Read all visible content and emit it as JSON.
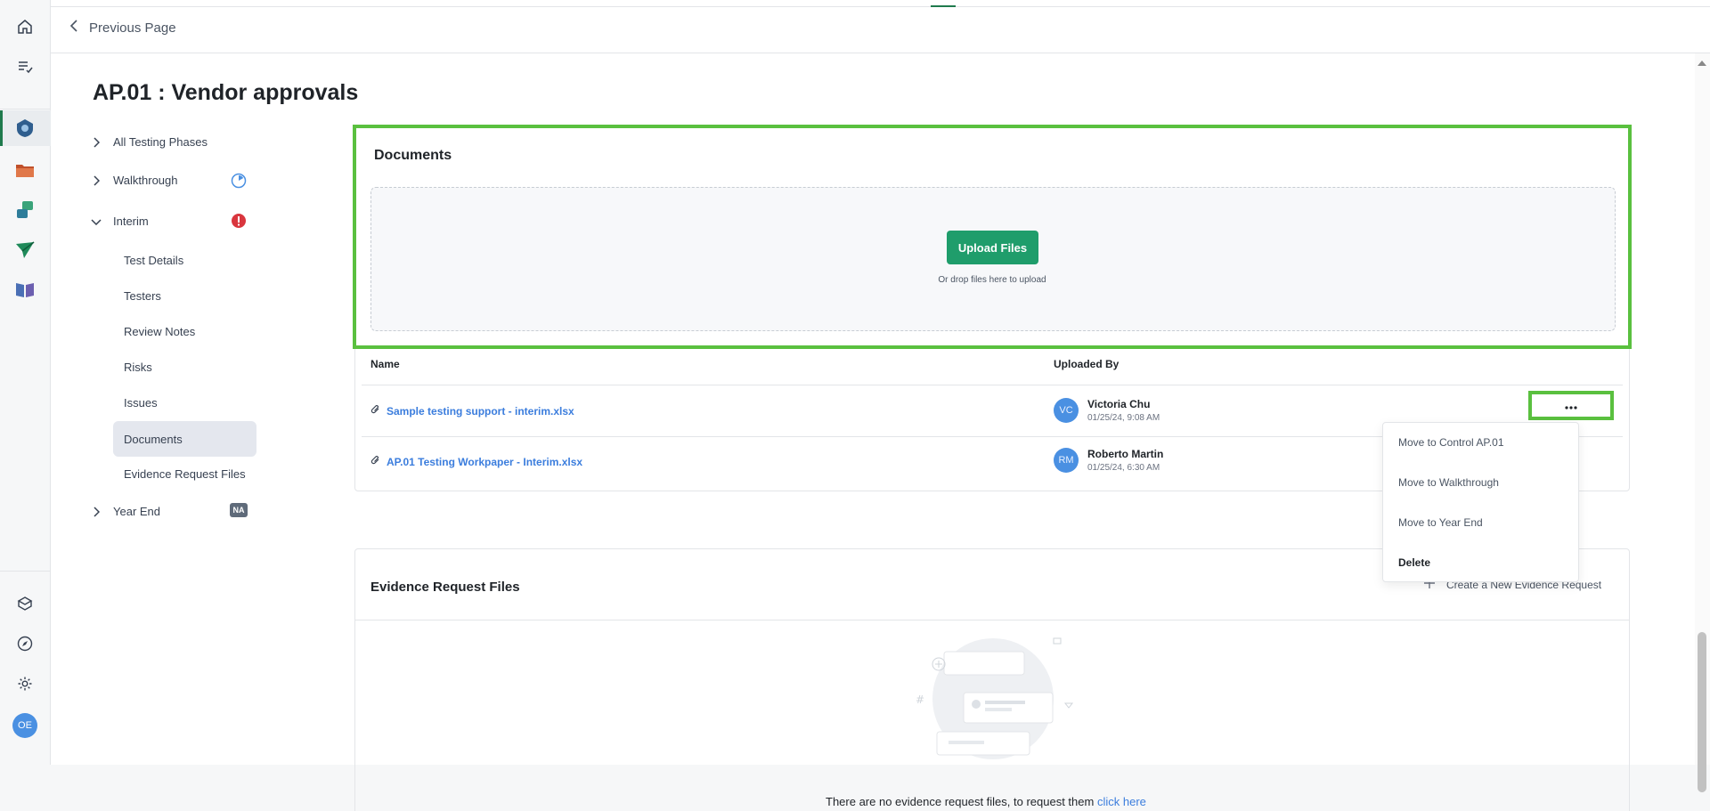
{
  "nav": {
    "back_label": "Previous Page",
    "rail_top_icons": [
      "home-icon",
      "checklist-icon"
    ],
    "rail_app_icons": [
      "controls-app-icon",
      "folder-app-icon",
      "workflow-app-icon",
      "send-app-icon",
      "library-app-icon"
    ],
    "rail_bottom_icons": [
      "cube-icon",
      "compass-icon",
      "gear-icon"
    ],
    "user_initials": "OE"
  },
  "page": {
    "title": "AP.01 : Vendor approvals"
  },
  "tree": {
    "phases": [
      {
        "label": "All Testing Phases",
        "expanded": false
      },
      {
        "label": "Walkthrough",
        "expanded": false,
        "status": "in-progress"
      },
      {
        "label": "Interim",
        "expanded": true,
        "status": "error"
      },
      {
        "label": "Year End",
        "expanded": false,
        "badge": "NA"
      }
    ],
    "interim_items": [
      "Test Details",
      "Testers",
      "Review Notes",
      "Risks",
      "Issues",
      "Documents",
      "Evidence Request Files"
    ],
    "active_item": "Documents"
  },
  "documents": {
    "title": "Documents",
    "upload_label": "Upload Files",
    "drop_hint": "Or drop files here to upload",
    "columns": {
      "name": "Name",
      "uploaded_by": "Uploaded By"
    },
    "files": [
      {
        "name": "Sample testing support - interim.xlsx",
        "initials": "VC",
        "user": "Victoria Chu",
        "date": "01/25/24, 9:08 AM"
      },
      {
        "name": "AP.01 Testing Workpaper - Interim.xlsx",
        "initials": "RM",
        "user": "Roberto Martin",
        "date": "01/25/24, 6:30 AM"
      }
    ],
    "more_label": "•••",
    "menu": [
      "Move to Control AP.01",
      "Move to Walkthrough",
      "Move to Year End",
      "Delete"
    ]
  },
  "evidence": {
    "title": "Evidence Request Files",
    "create_label": "Create a New Evidence Request",
    "empty_text": "There are no evidence request files, to request them",
    "empty_link": "click here"
  },
  "colors": {
    "accent_green": "#1f9d6b",
    "highlight_green": "#5ac03f",
    "link_blue": "#3b7ddd",
    "error_red": "#d9363e",
    "avatar_blue": "#4a90e2"
  }
}
